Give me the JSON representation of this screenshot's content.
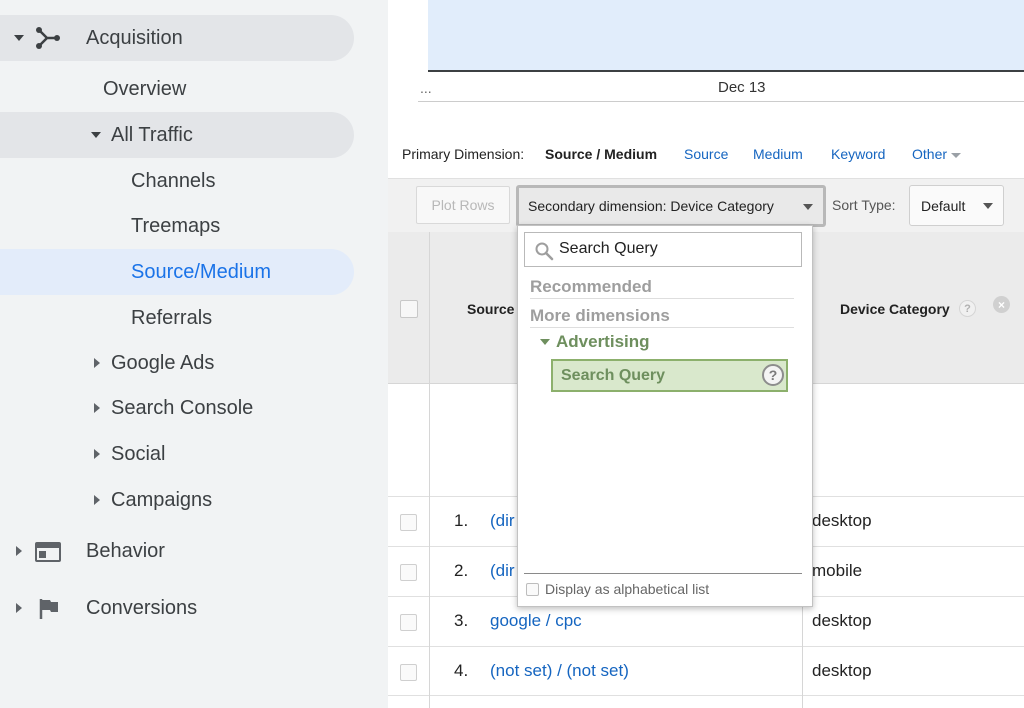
{
  "sidebar": {
    "acquisition": "Acquisition",
    "overview": "Overview",
    "all_traffic": "All Traffic",
    "channels": "Channels",
    "treemaps": "Treemaps",
    "source_medium": "Source/Medium",
    "referrals": "Referrals",
    "google_ads": "Google Ads",
    "search_console": "Search Console",
    "social": "Social",
    "campaigns": "Campaigns",
    "behavior": "Behavior",
    "conversions": "Conversions"
  },
  "chart": {
    "ellipsis": "...",
    "date_label": "Dec 13"
  },
  "primary_dimension": {
    "label": "Primary Dimension:",
    "active": "Source / Medium",
    "source": "Source",
    "medium": "Medium",
    "keyword": "Keyword",
    "other": "Other"
  },
  "toolbar": {
    "plot_rows": "Plot Rows",
    "secondary_dimension": "Secondary dimension: Device Category",
    "sort_type_label": "Sort Type:",
    "sort_type_value": "Default"
  },
  "table": {
    "header_source": "Source",
    "header_device": "Device Category",
    "help_glyph": "?",
    "remove_glyph": "×",
    "rows": [
      {
        "num": "1.",
        "source": "(dir",
        "device": "desktop"
      },
      {
        "num": "2.",
        "source": "(dir",
        "device": "mobile"
      },
      {
        "num": "3.",
        "source": "google / cpc",
        "device": "desktop"
      },
      {
        "num": "4.",
        "source": "(not set) / (not set)",
        "device": "desktop"
      }
    ]
  },
  "dropdown": {
    "search_value": "Search Query",
    "recommended": "Recommended",
    "more_dimensions": "More dimensions",
    "group": "Advertising",
    "item": "Search Query",
    "item_help": "?",
    "alphabetical": "Display as alphabetical list"
  },
  "colors": {
    "sidebar_bg": "#f1f3f4",
    "active_link": "#1a73e8",
    "link": "#1565c0",
    "selection_green": "#d9e8cc",
    "chart_fill": "#e1edfb"
  }
}
